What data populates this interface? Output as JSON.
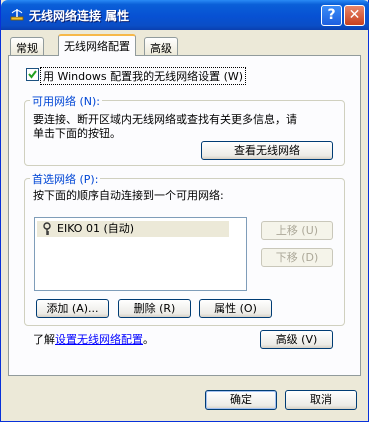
{
  "window": {
    "title": "无线网络连接 属性",
    "help_label": "?",
    "close_label": "✕"
  },
  "tabs": [
    {
      "label": "常规"
    },
    {
      "label": "无线网络配置"
    },
    {
      "label": "高级"
    }
  ],
  "config": {
    "use_windows_label": "用 Windows 配置我的无线网络设置 (W)",
    "checked": true
  },
  "available": {
    "legend": "可用网络 (N):",
    "line1": "要连接、断开区域内无线网络或查找有关更多信息，请",
    "line2": "单击下面的按钮。",
    "view_button": "查看无线网络"
  },
  "preferred": {
    "legend": "首选网络 (P):",
    "desc": "按下面的顺序自动连接到一个可用网络:",
    "items": [
      {
        "label": "EIKO 01 (自动)"
      }
    ],
    "move_up": "上移 (U)",
    "move_down": "下移 (D)",
    "add": "添加 (A)...",
    "delete": "删除 (R)",
    "properties": "属性 (O)"
  },
  "learn": {
    "prefix": "了解",
    "link": "设置无线网络配置",
    "suffix": "。"
  },
  "advanced_button": "高级 (V)",
  "footer": {
    "ok": "确定",
    "cancel": "取消"
  },
  "colors": {
    "title_bar": "#0751d3",
    "dialog_bg": "#ece9d8",
    "group_legend": "#0046d5",
    "link": "#0000ff"
  },
  "icons": {
    "title": "network-icon",
    "list_item": "wireless-key-icon"
  }
}
